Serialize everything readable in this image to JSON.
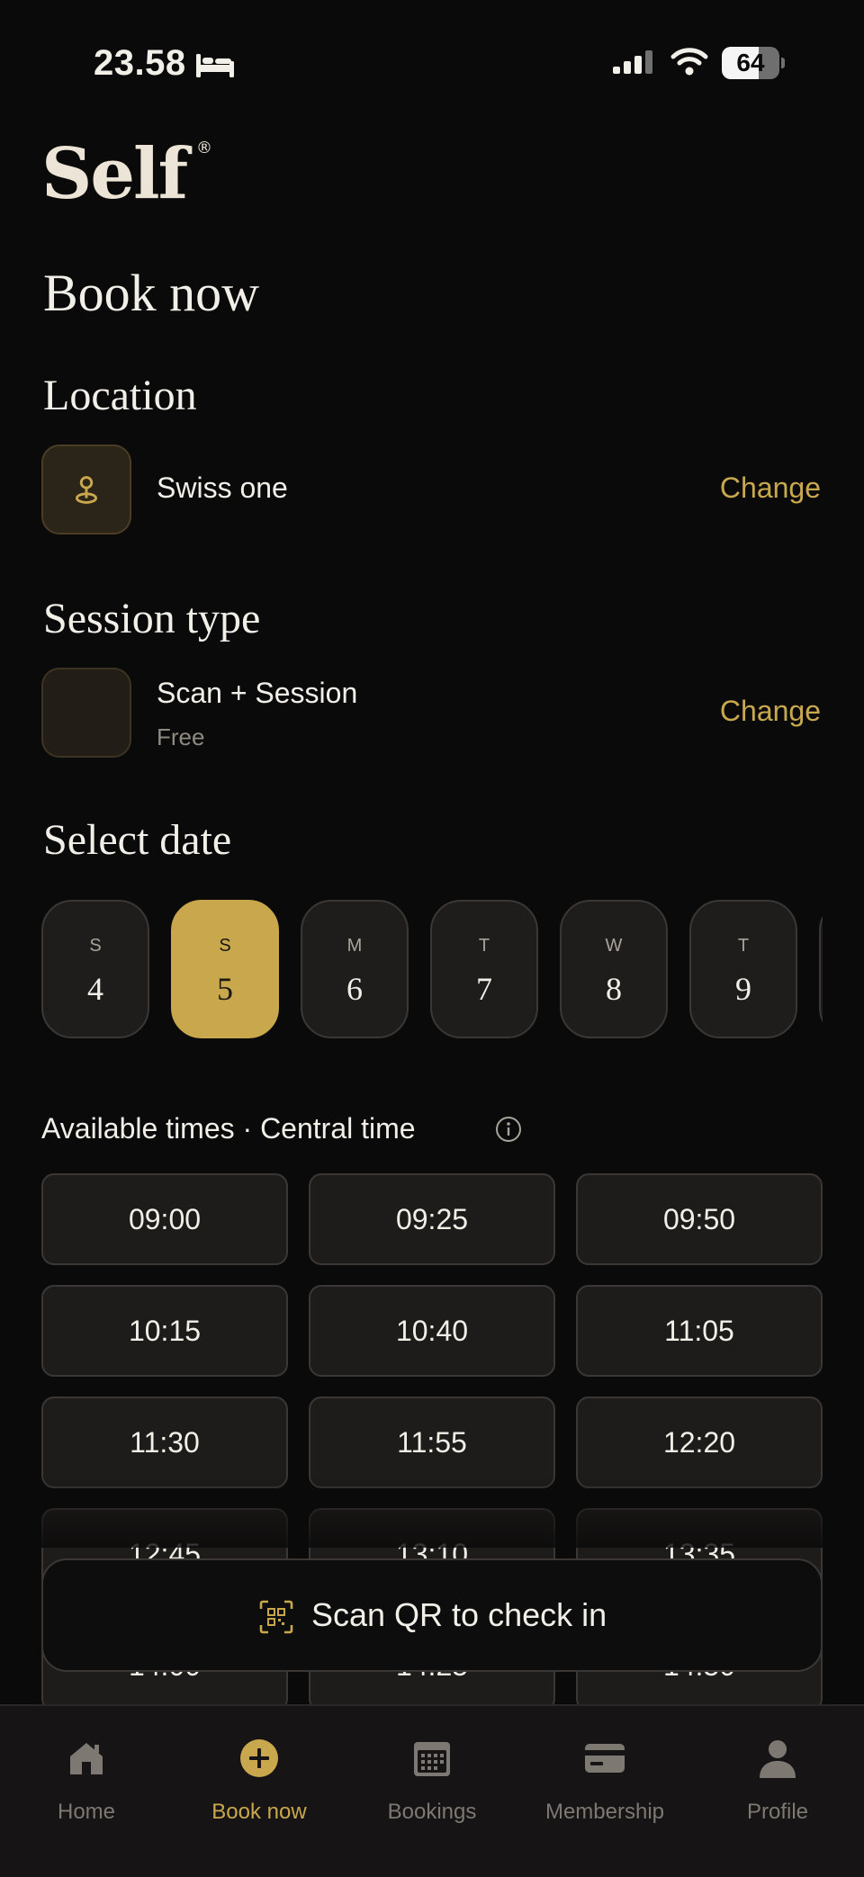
{
  "status_bar": {
    "time": "23.58",
    "battery": "64",
    "battery_level": 0.64
  },
  "brand": {
    "name": "Self",
    "mark": "®"
  },
  "page": {
    "title": "Book now"
  },
  "location": {
    "heading": "Location",
    "name": "Swiss one",
    "change_label": "Change"
  },
  "session": {
    "heading": "Session type",
    "name": "Scan + Session",
    "price": "Free",
    "change_label": "Change"
  },
  "date": {
    "heading": "Select date",
    "days": [
      {
        "dow": "S",
        "num": "4"
      },
      {
        "dow": "S",
        "num": "5"
      },
      {
        "dow": "M",
        "num": "6"
      },
      {
        "dow": "T",
        "num": "7"
      },
      {
        "dow": "W",
        "num": "8"
      },
      {
        "dow": "T",
        "num": "9"
      }
    ],
    "selected_index": 1
  },
  "times": {
    "heading": "Available times · Central time",
    "slots": [
      "09:00",
      "09:25",
      "09:50",
      "10:15",
      "10:40",
      "11:05",
      "11:30",
      "11:55",
      "12:20",
      "12:45",
      "13:10",
      "13:35",
      "14:00",
      "14:25",
      "14:50"
    ]
  },
  "scan": {
    "label": "Scan QR to check in"
  },
  "tabs": [
    {
      "label": "Home",
      "icon": "home-icon"
    },
    {
      "label": "Book now",
      "icon": "plus-circle-icon"
    },
    {
      "label": "Bookings",
      "icon": "calendar-icon"
    },
    {
      "label": "Membership",
      "icon": "card-icon"
    },
    {
      "label": "Profile",
      "icon": "person-icon"
    }
  ],
  "active_tab": 1,
  "colors": {
    "accent": "#c9a84d",
    "background": "#0b0a0a",
    "card": "#1e1c1b"
  }
}
